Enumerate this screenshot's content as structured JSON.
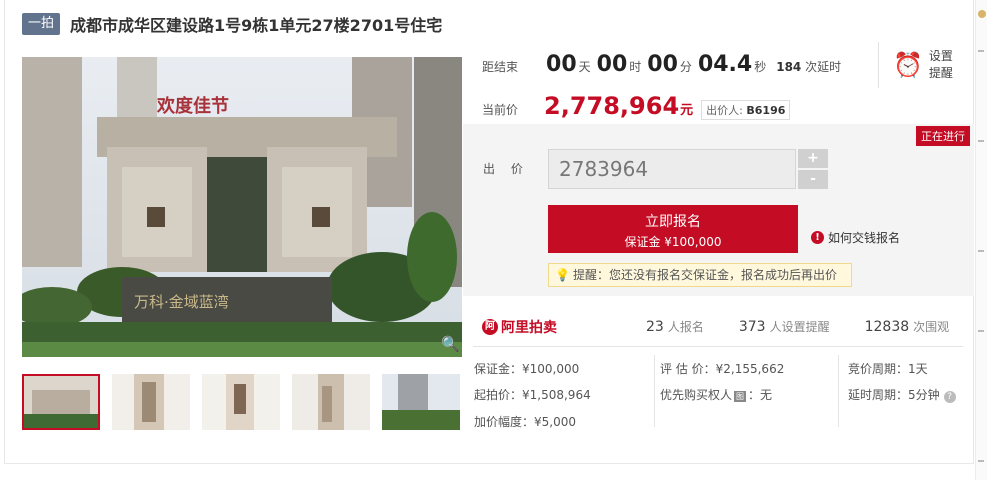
{
  "header": {
    "tag": "一拍",
    "title": "成都市成华区建设路1号9栋1单元27楼2701号住宅"
  },
  "image": {
    "sign_text": "欢度佳节",
    "wall_text": "万科·金域蓝湾"
  },
  "countdown": {
    "label": "距结束",
    "days": "00",
    "days_unit": "天",
    "hours": "00",
    "hours_unit": "时",
    "minutes": "00",
    "minutes_unit": "分",
    "seconds": "04.4",
    "seconds_unit": "秒",
    "extensions_count": "184",
    "extensions_label": "次延时"
  },
  "reminder": {
    "label": "设置提醒"
  },
  "current_price": {
    "label": "当前价",
    "value": "2,778,964",
    "unit": "元",
    "bidder_label": "出价人:",
    "bidder_id": "B6196"
  },
  "status_badge": "正在进行",
  "bid": {
    "label": "出 价",
    "value": "2783964",
    "increment": "+",
    "decrement": "-"
  },
  "signup_button": {
    "title": "立即报名",
    "deposit": "保证金 ¥100,000"
  },
  "how_to": "如何交钱报名",
  "tip": "提醒：您还没有报名交保证金，报名成功后再出价",
  "brand": {
    "logo": "阿",
    "name": "阿里拍卖"
  },
  "stats": [
    {
      "num": "23",
      "label": "人报名"
    },
    {
      "num": "373",
      "label": "人设置提醒"
    },
    {
      "num": "12838",
      "label": "次围观"
    }
  ],
  "info": {
    "deposit": "保证金：¥100,000",
    "start_price": "起拍价：¥1,508,964",
    "increment": "加价幅度：¥5,000",
    "appraisal": "评 估 价：¥2,155,662",
    "priority_label": "优先购买权人",
    "priority_badge": "图",
    "priority_value": "：无",
    "period": "竞价周期：1天",
    "delay": "延时周期：5分钟"
  },
  "colors": {
    "accent": "#c40c24",
    "tag": "#62738e"
  }
}
